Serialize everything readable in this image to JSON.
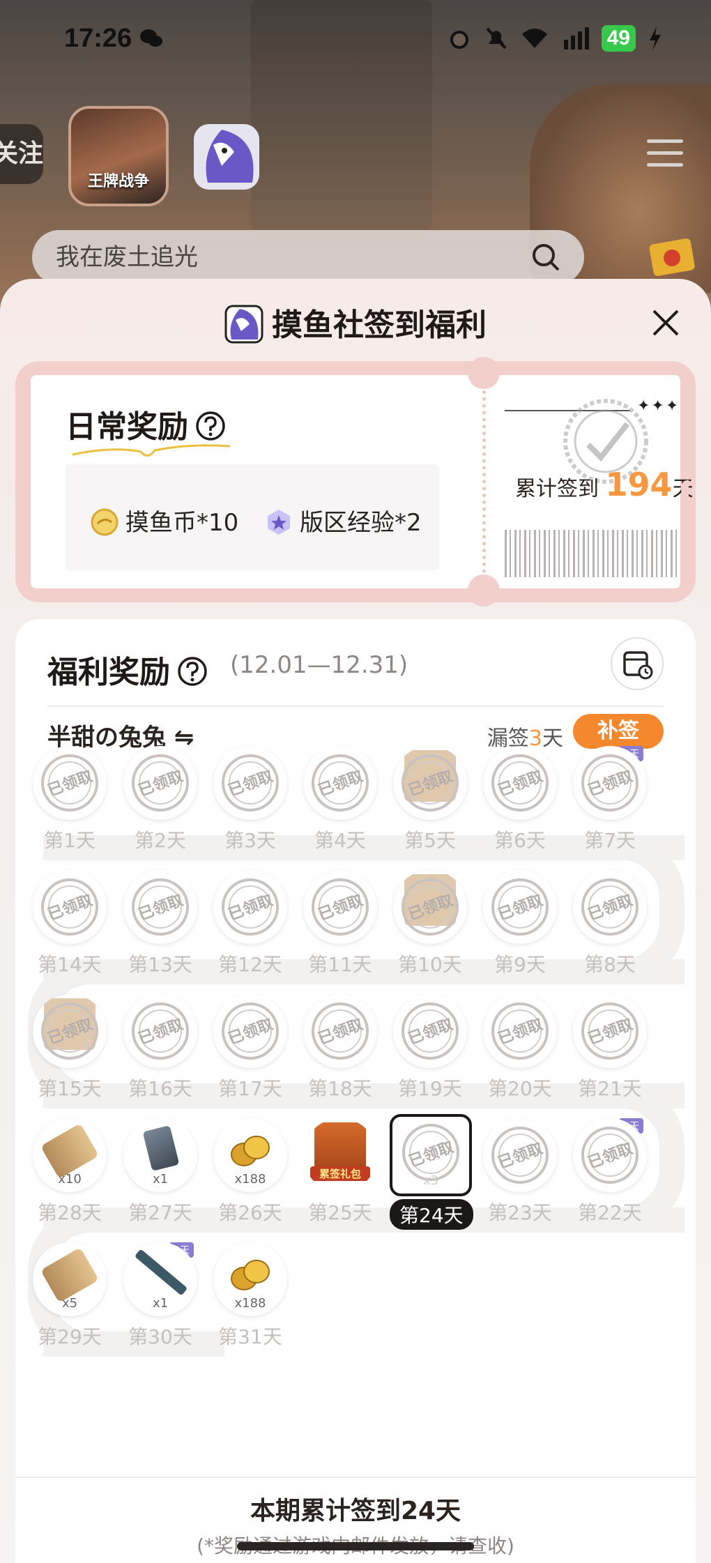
{
  "status": {
    "time": "17:26",
    "battery": "49"
  },
  "header": {
    "follow_label": "关注",
    "game_name": "王牌战争",
    "search_placeholder": "我在废土追光"
  },
  "sheet": {
    "title": "摸鱼社签到福利",
    "daily": {
      "title": "日常奖励",
      "rewards": [
        {
          "label": "摸鱼币*10",
          "icon": "coin-icon"
        },
        {
          "label": "版区经验*2",
          "icon": "star-badge-icon"
        }
      ],
      "cumulative_prefix": "累计签到",
      "cumulative_days": "194",
      "cumulative_suffix": "天"
    },
    "benefits": {
      "title": "福利奖励",
      "range": "(12.01—12.31)",
      "username": "半甜の兔兔 ⇋",
      "missed_prefix": "漏签",
      "missed_days": "3",
      "missed_suffix": "天",
      "makeup_label": "补签",
      "claimed_text": "已领取",
      "gift_label": "累签礼包",
      "days": [
        {
          "label": "第1天",
          "state": "claimed"
        },
        {
          "label": "第2天",
          "state": "claimed"
        },
        {
          "label": "第3天",
          "state": "claimed"
        },
        {
          "label": "第4天",
          "state": "claimed"
        },
        {
          "label": "第5天",
          "state": "claimed",
          "gift": true
        },
        {
          "label": "第6天",
          "state": "claimed"
        },
        {
          "label": "第7天",
          "state": "claimed",
          "tag": "3天"
        },
        {
          "label": "第14天",
          "state": "claimed"
        },
        {
          "label": "第13天",
          "state": "claimed"
        },
        {
          "label": "第12天",
          "state": "claimed"
        },
        {
          "label": "第11天",
          "state": "claimed"
        },
        {
          "label": "第10天",
          "state": "claimed",
          "gift": true
        },
        {
          "label": "第9天",
          "state": "claimed"
        },
        {
          "label": "第8天",
          "state": "claimed"
        },
        {
          "label": "第15天",
          "state": "claimed",
          "gift": true
        },
        {
          "label": "第16天",
          "state": "claimed"
        },
        {
          "label": "第17天",
          "state": "claimed"
        },
        {
          "label": "第18天",
          "state": "claimed"
        },
        {
          "label": "第19天",
          "state": "claimed"
        },
        {
          "label": "第20天",
          "state": "claimed"
        },
        {
          "label": "第21天",
          "state": "claimed"
        },
        {
          "label": "第28天",
          "state": "pending",
          "item": "arrow",
          "qty": "x10"
        },
        {
          "label": "第27天",
          "state": "pending",
          "item": "card",
          "qty": "x1"
        },
        {
          "label": "第26天",
          "state": "pending",
          "item": "coin",
          "qty": "x188"
        },
        {
          "label": "第25天",
          "state": "pending",
          "item": "giftbox"
        },
        {
          "label": "第24天",
          "state": "today",
          "qty": "x3"
        },
        {
          "label": "第23天",
          "state": "claimed"
        },
        {
          "label": "第22天",
          "state": "claimed",
          "tag": "3天"
        },
        {
          "label": "第29天",
          "state": "pending",
          "item": "arrow",
          "qty": "x5"
        },
        {
          "label": "第30天",
          "state": "pending",
          "item": "gun",
          "qty": "x1",
          "tag": "3天"
        },
        {
          "label": "第31天",
          "state": "pending",
          "item": "coin",
          "qty": "x188"
        }
      ]
    },
    "footer": {
      "title": "本期累计签到24天",
      "note": "(*奖励通过游戏内邮件发放，请查收)"
    }
  },
  "colors": {
    "accent": "#f5872d",
    "highlight": "#f5983f",
    "ticket_border": "#f2cfcb"
  }
}
